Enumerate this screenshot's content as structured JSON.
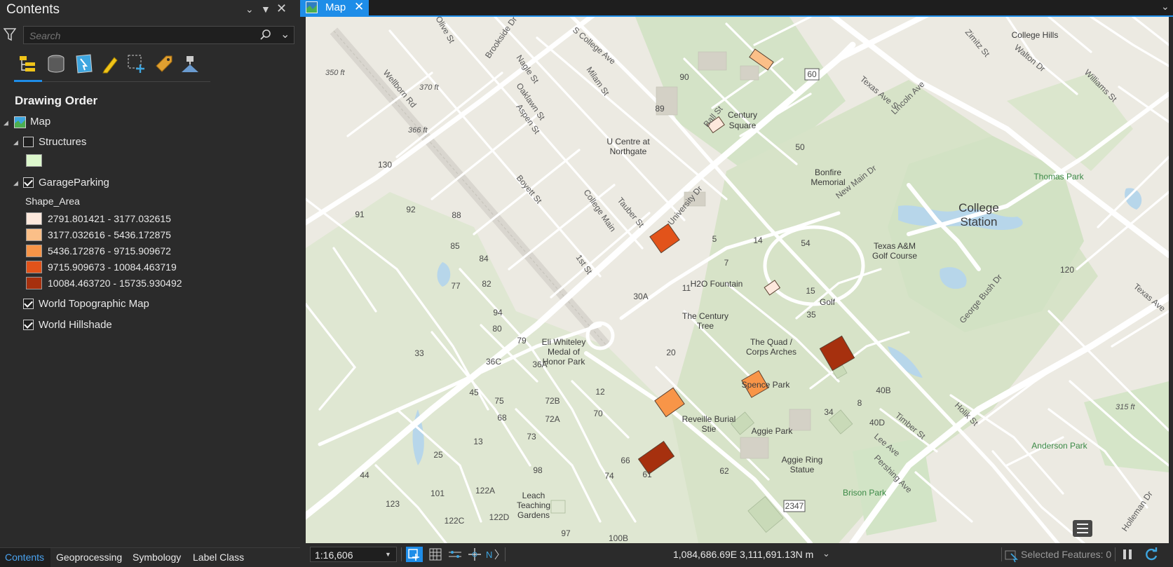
{
  "contents_pane": {
    "title": "Contents",
    "search": {
      "placeholder": "Search"
    },
    "toolbar_icons": [
      "list-by-drawing-order-icon",
      "list-by-source-icon",
      "list-by-selection-icon",
      "list-by-editing-icon",
      "list-by-snapping-icon",
      "list-by-labeling-icon",
      "list-by-perspective-imagery-icon"
    ],
    "section_title": "Drawing Order",
    "map_name": "Map",
    "layers": [
      {
        "name": "Structures",
        "checked": false,
        "swatch": "#dcf7cc"
      },
      {
        "name": "GarageParking",
        "checked": true,
        "field": "Shape_Area",
        "classes": [
          {
            "label": "2791.801421 - 3177.032615",
            "color": "#fde8dc"
          },
          {
            "label": "3177.032616 - 5436.172875",
            "color": "#fbbf88"
          },
          {
            "label": "5436.172876 - 9715.909672",
            "color": "#f89548"
          },
          {
            "label": "9715.909673 - 10084.463719",
            "color": "#e2531a"
          },
          {
            "label": "10084.463720 - 15735.930492",
            "color": "#a6300e"
          }
        ]
      },
      {
        "name": "World Topographic Map",
        "checked": true
      },
      {
        "name": "World Hillshade",
        "checked": true
      }
    ],
    "bottom_tabs": [
      "Contents",
      "Geoprocessing",
      "Symbology",
      "Label Class"
    ],
    "active_tab": "Contents"
  },
  "map_view": {
    "tab_label": "Map",
    "scale": "1:16,606",
    "coordinates": "1,084,686.69E 3,111,691.13N m",
    "selected_features": "Selected Features: 0",
    "accent_color": "#1e8de8"
  },
  "map_labels": {
    "streets": [
      "Wellborn Rd",
      "Olive St",
      "Brookside Dr",
      "S College Ave",
      "Nagle St",
      "Milam St",
      "Oaklawn St",
      "Aspen St",
      "Ball St",
      "Boyett St",
      "College Main",
      "Tauber St",
      "University Dr",
      "1st St",
      "Texas Ave S",
      "Lincoln Ave",
      "Walton Dr",
      "Williams St",
      "New Main Dr",
      "George Bush Dr",
      "Timber St",
      "Lee Ave",
      "Pershing Ave",
      "Holik St",
      "Holleman Dr",
      "Texas Ave",
      "Zimitz St"
    ],
    "places": [
      "U Centre at Northgate",
      "Century Square",
      "Bonfire Memorial",
      "H2O Fountain",
      "The Century Tree",
      "The Quad / Corps Arches",
      "Spence Park",
      "Reveille Burial Stie",
      "Aggie Park",
      "Aggie Ring Statue",
      "Eli Whiteley Medal of Honor Park",
      "Leach Teaching Gardens",
      "Texas A&M Golf Course",
      "Golf",
      "College Hills"
    ],
    "city": "College Station",
    "parks": [
      "Thomas Park",
      "Anderson Park",
      "Brison Park"
    ],
    "elevations": [
      "350 ft",
      "370 ft",
      "366 ft",
      "315 ft"
    ],
    "highway_shields": [
      "60",
      "2347"
    ],
    "building_numbers": [
      "90",
      "89",
      "50",
      "130",
      "91",
      "92",
      "88",
      "85",
      "84",
      "77",
      "82",
      "94",
      "80",
      "79",
      "33",
      "36C",
      "36A",
      "45",
      "75",
      "72B",
      "72A",
      "12",
      "70",
      "68",
      "73",
      "13",
      "25",
      "98",
      "66",
      "61",
      "74",
      "62",
      "44",
      "101",
      "122A",
      "123",
      "122C",
      "122D",
      "97",
      "100B",
      "5",
      "14",
      "54",
      "7",
      "11",
      "30A",
      "15",
      "35",
      "20",
      "34",
      "8",
      "40B",
      "40D",
      "120"
    ]
  }
}
